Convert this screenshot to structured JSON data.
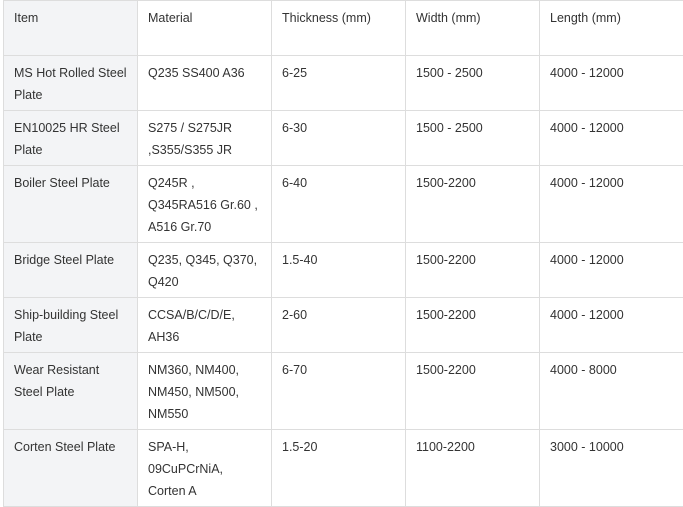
{
  "table": {
    "headers": [
      "Item",
      "Material",
      "Thickness (mm)",
      "Width (mm)",
      "Length (mm)"
    ],
    "rows": [
      [
        "MS Hot Rolled Steel Plate",
        "Q235 SS400 A36",
        "6-25",
        "1500 - 2500",
        "4000 - 12000"
      ],
      [
        "EN10025 HR Steel Plate",
        "S275 / S275JR ,S355/S355 JR",
        "6-30",
        "1500 - 2500",
        "4000 - 12000"
      ],
      [
        "Boiler Steel Plate",
        "Q245R , Q345RA516 Gr.60 , A516 Gr.70",
        "6-40",
        "1500-2200",
        "4000 - 12000"
      ],
      [
        "Bridge Steel Plate",
        "Q235, Q345, Q370, Q420",
        "1.5-40",
        "1500-2200",
        "4000 - 12000"
      ],
      [
        "Ship-building Steel Plate",
        "CCSA/B/C/D/E, AH36",
        "2-60",
        "1500-2200",
        "4000 - 12000"
      ],
      [
        "Wear Resistant Steel Plate",
        "NM360, NM400, NM450, NM500, NM550",
        "6-70",
        "1500-2200",
        "4000 - 8000"
      ],
      [
        "Corten Steel Plate",
        "SPA-H, 09CuPCrNiA, Corten A",
        "1.5-20",
        "1100-2200",
        "3000 - 10000"
      ]
    ]
  }
}
